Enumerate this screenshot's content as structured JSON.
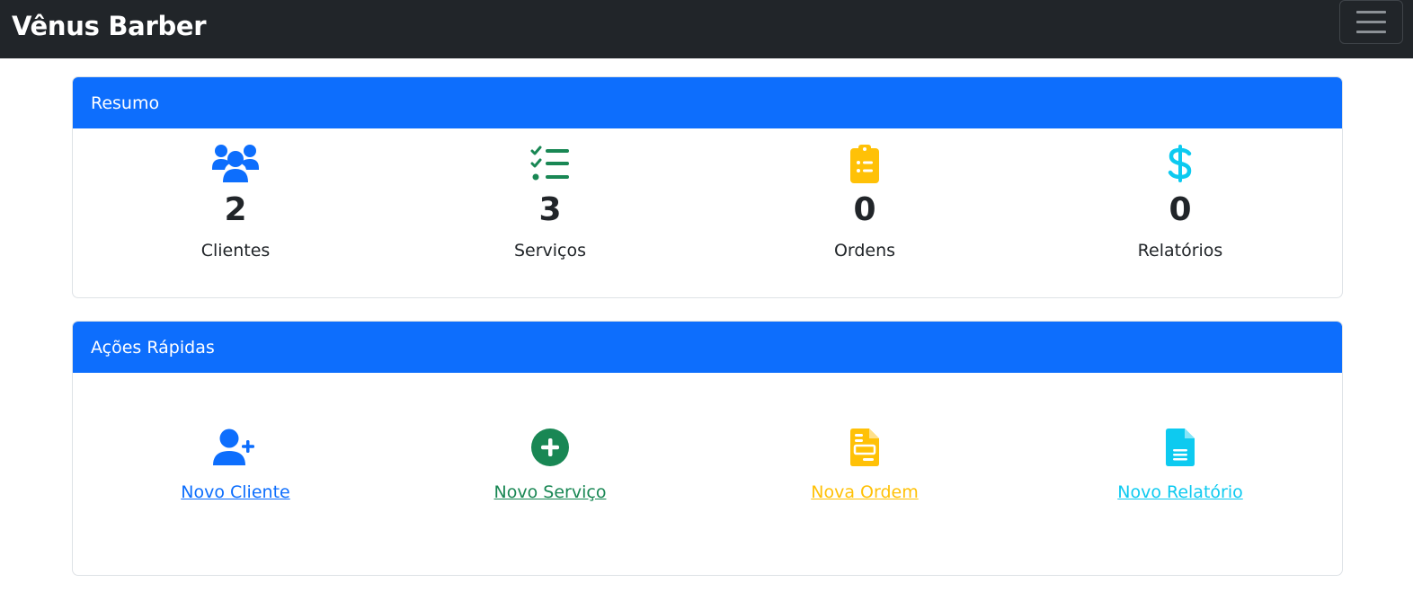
{
  "navbar": {
    "brand": "Vênus Barber",
    "menu_icon": "hamburger-menu-icon"
  },
  "colors": {
    "navbar_bg": "#212529",
    "primary": "#0d6efd",
    "success": "#198754",
    "warning": "#ffc107",
    "info": "#0dcaf0"
  },
  "summary": {
    "title": "Resumo",
    "stats": [
      {
        "icon": "users-icon",
        "value": "2",
        "label": "Clientes"
      },
      {
        "icon": "list-check-icon",
        "value": "3",
        "label": "Serviços"
      },
      {
        "icon": "clipboard-list-icon",
        "value": "0",
        "label": "Ordens"
      },
      {
        "icon": "dollar-icon",
        "value": "0",
        "label": "Relatórios"
      }
    ]
  },
  "actions": {
    "title": "Ações Rápidas",
    "items": [
      {
        "icon": "user-plus-icon",
        "label": "Novo Cliente"
      },
      {
        "icon": "plus-circle-icon",
        "label": "Novo Serviço"
      },
      {
        "icon": "file-invoice-icon",
        "label": "Nova Ordem"
      },
      {
        "icon": "file-lines-icon",
        "label": "Novo Relatório"
      }
    ]
  }
}
